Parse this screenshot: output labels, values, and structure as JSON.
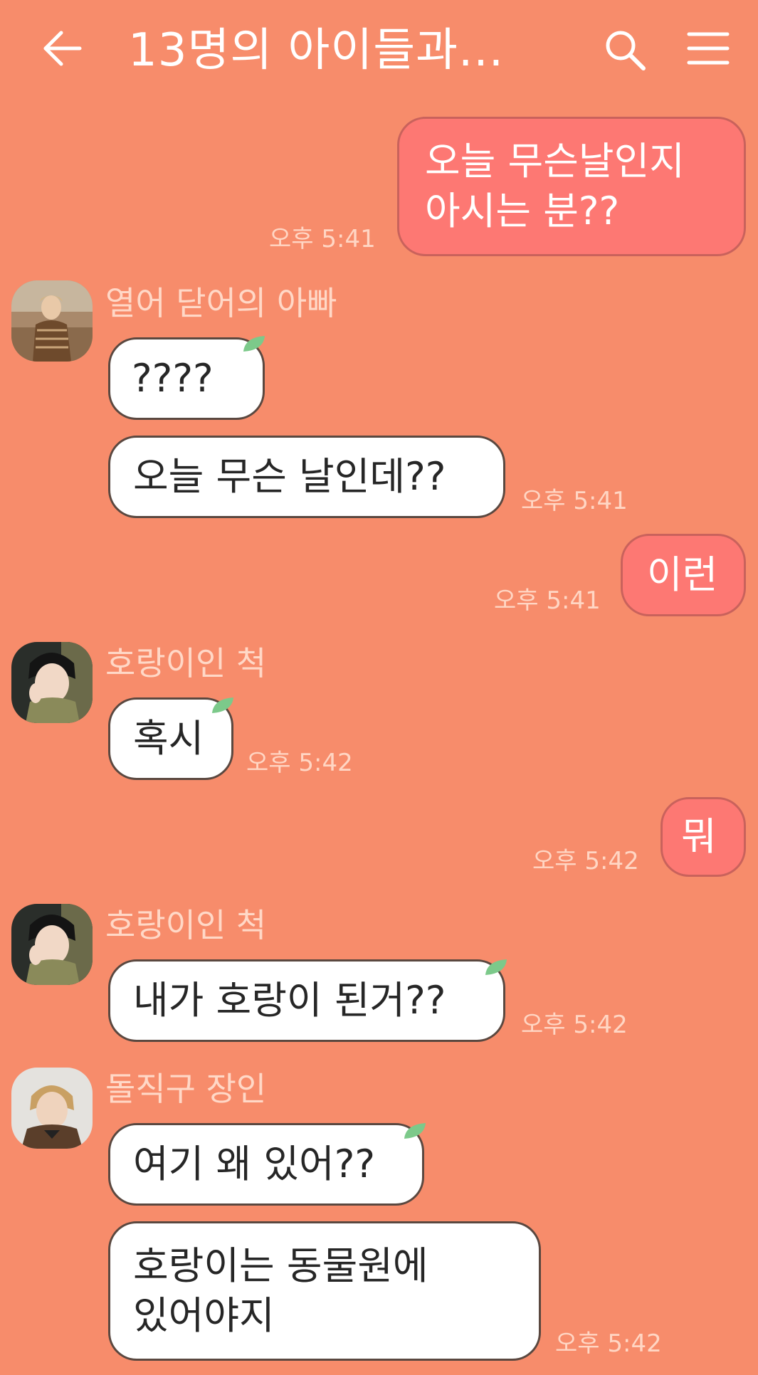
{
  "header": {
    "title": "13명의 아이들과...",
    "back_icon": "arrow-left-icon",
    "search_icon": "search-icon",
    "menu_icon": "hamburger-menu-icon"
  },
  "colors": {
    "background": "#f78c6b",
    "my_bubble": "#fd7873",
    "their_bubble": "#ffffff",
    "timestamp": "#ffd6c4",
    "leaf": "#7cc98a"
  },
  "messages": [
    {
      "side": "right",
      "lines": [
        "오늘 무슨날인지",
        "아시는 분??"
      ],
      "time": "오후 5:41"
    },
    {
      "side": "left",
      "sender": "열어 닫어의 아빠",
      "text": "????"
    },
    {
      "side": "left",
      "text": "오늘 무슨 날인데??",
      "time": "오후 5:41"
    },
    {
      "side": "right",
      "text": "이런",
      "time": "오후 5:41"
    },
    {
      "side": "left",
      "sender": "호랑이인 척",
      "text": "혹시",
      "time": "오후 5:42"
    },
    {
      "side": "right",
      "text": "뭐",
      "time": "오후 5:42"
    },
    {
      "side": "left",
      "sender": "호랑이인 척",
      "text": "내가 호랑이 된거??",
      "time": "오후 5:42"
    },
    {
      "side": "left",
      "sender": "돌직구 장인",
      "text": "여기 왜 있어??"
    },
    {
      "side": "left",
      "lines": [
        "호랑이는 동물원에",
        "있어야지"
      ],
      "time": "오후 5:42"
    }
  ]
}
